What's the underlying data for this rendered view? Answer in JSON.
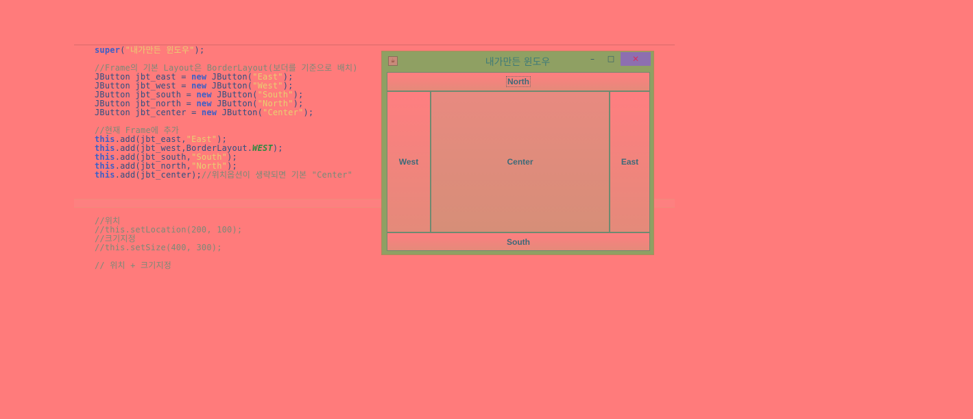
{
  "editor": {
    "lines": [
      [
        {
          "t": "super",
          "c": "kw"
        },
        {
          "t": "(",
          "c": ""
        },
        {
          "t": "\"내가만든 윈도우\"",
          "c": "str"
        },
        {
          "t": ");",
          "c": ""
        }
      ],
      [],
      [
        {
          "t": "//Frame의 기본 Layout은 BorderLayout(보더를 기준으로 배치)",
          "c": "cmt"
        }
      ],
      [
        {
          "t": "JButton jbt_east = ",
          "c": ""
        },
        {
          "t": "new",
          "c": "kw"
        },
        {
          "t": " JButton(",
          "c": ""
        },
        {
          "t": "\"East\"",
          "c": "str"
        },
        {
          "t": ");",
          "c": ""
        }
      ],
      [
        {
          "t": "JButton jbt_west = ",
          "c": ""
        },
        {
          "t": "new",
          "c": "kw"
        },
        {
          "t": " JButton(",
          "c": ""
        },
        {
          "t": "\"West\"",
          "c": "str"
        },
        {
          "t": ");",
          "c": ""
        }
      ],
      [
        {
          "t": "JButton jbt_south = ",
          "c": ""
        },
        {
          "t": "new",
          "c": "kw"
        },
        {
          "t": " JButton(",
          "c": ""
        },
        {
          "t": "\"South\"",
          "c": "str"
        },
        {
          "t": ");",
          "c": ""
        }
      ],
      [
        {
          "t": "JButton jbt_north = ",
          "c": ""
        },
        {
          "t": "new",
          "c": "kw"
        },
        {
          "t": " JButton(",
          "c": ""
        },
        {
          "t": "\"North\"",
          "c": "str"
        },
        {
          "t": ");",
          "c": ""
        }
      ],
      [
        {
          "t": "JButton jbt_center = ",
          "c": ""
        },
        {
          "t": "new",
          "c": "kw"
        },
        {
          "t": " JButton(",
          "c": ""
        },
        {
          "t": "\"Center\"",
          "c": "str"
        },
        {
          "t": ");",
          "c": ""
        }
      ],
      [],
      [
        {
          "t": "//현재 Frame에 추가",
          "c": "cmt"
        }
      ],
      [
        {
          "t": "this",
          "c": "kw"
        },
        {
          "t": ".add(jbt_east,",
          "c": ""
        },
        {
          "t": "\"East\"",
          "c": "str"
        },
        {
          "t": ");",
          "c": ""
        }
      ],
      [
        {
          "t": "this",
          "c": "kw"
        },
        {
          "t": ".add(jbt_west,BorderLayout.",
          "c": ""
        },
        {
          "t": "WEST",
          "c": "fld"
        },
        {
          "t": ");",
          "c": ""
        }
      ],
      [
        {
          "t": "this",
          "c": "kw"
        },
        {
          "t": ".add(jbt_south,",
          "c": ""
        },
        {
          "t": "\"South\"",
          "c": "str"
        },
        {
          "t": ");",
          "c": ""
        }
      ],
      [
        {
          "t": "this",
          "c": "kw"
        },
        {
          "t": ".add(jbt_north,",
          "c": ""
        },
        {
          "t": "\"North\"",
          "c": "str"
        },
        {
          "t": ");",
          "c": ""
        }
      ],
      [
        {
          "t": "this",
          "c": "kw"
        },
        {
          "t": ".add(jbt_center);",
          "c": ""
        },
        {
          "t": "//위치옵션이 생략되면 기본 \"Center\"",
          "c": "cmt"
        }
      ]
    ],
    "lines2": [
      [
        {
          "t": "//위치",
          "c": "cmt"
        }
      ],
      [
        {
          "t": "//this.setLocation(200, 100);",
          "c": "cmt"
        }
      ],
      [
        {
          "t": "//크기지정",
          "c": "cmt"
        }
      ],
      [
        {
          "t": "//this.setSize(400, 300);",
          "c": "cmt"
        }
      ],
      [],
      [
        {
          "t": "// 위치 + 크기지정",
          "c": "cmt"
        }
      ]
    ]
  },
  "window": {
    "title": "내가만든 윈도우",
    "min_glyph": "–",
    "max_glyph": "□",
    "close_glyph": "✕",
    "app_icon_glyph": "☕"
  },
  "buttons": {
    "north": "North",
    "west": "West",
    "center": "Center",
    "east": "East",
    "south": "South"
  }
}
